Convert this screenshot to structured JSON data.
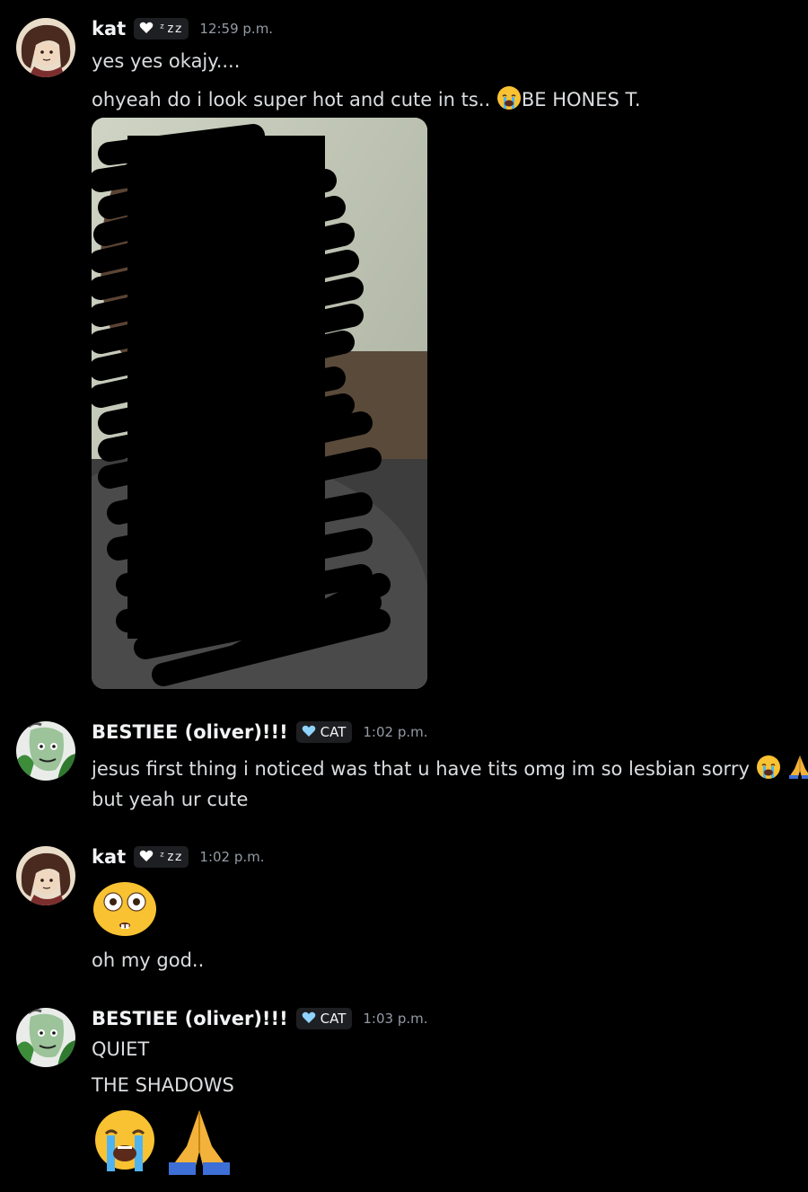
{
  "messages": [
    {
      "author": "kat",
      "tag": "ᶻz𝗓",
      "time": "12:59 p.m.",
      "lines": [
        "yes yes okajy....",
        "ohyeah do i look super hot and cute in ts..",
        "BE HONES T."
      ],
      "attachment": "censored-photo"
    },
    {
      "author": "BESTIEE (oliver)!!!",
      "tag": "CAT",
      "time": "1:02 p.m.",
      "lines": [
        "jesus first thing i noticed was that u have tits omg im so lesbian sorry",
        "but yeah ur cute"
      ]
    },
    {
      "author": "kat",
      "tag": "ᶻz𝗓",
      "time": "1:02 p.m.",
      "lines": [
        "oh my god.."
      ]
    },
    {
      "author": "BESTIEE (oliver)!!!",
      "tag": "CAT",
      "time": "1:03 p.m.",
      "lines": [
        "QUIET",
        "THE SHADOWS"
      ]
    }
  ],
  "colors": {
    "background": "#000000",
    "username": "#f2f3f5",
    "text": "#dbdee1",
    "timestamp": "#949ba4",
    "tag_bg": "#1e1f22",
    "heart_tag_white": "#ffffff",
    "heart_tag_blue": "#8fd3ff"
  },
  "icons": [
    "white-heart-icon",
    "blue-heart-icon",
    "loudly-crying-face-emoji",
    "folded-hands-emoji",
    "flushed-face-emoji"
  ]
}
